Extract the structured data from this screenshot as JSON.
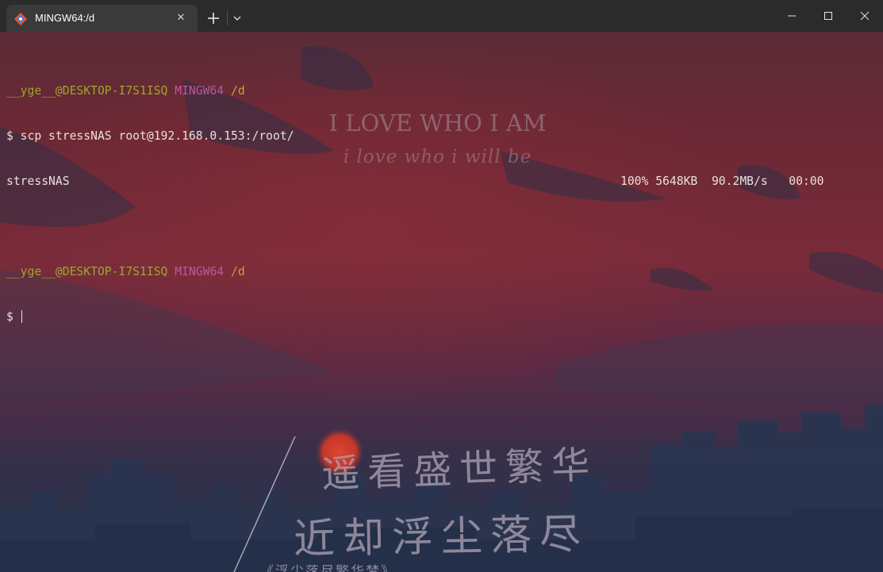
{
  "tab": {
    "title": "MINGW64:/d",
    "close_glyph": "✕",
    "icon": "git-bash-icon"
  },
  "window_controls": [
    "minimize-icon",
    "maximize-icon",
    "close-icon"
  ],
  "terminal": {
    "prompt1": {
      "user": "__yge__@DESKTOP-I7S1ISQ",
      "system": "MINGW64",
      "path": "/d"
    },
    "command": "$ scp stressNAS root@192.168.0.153:/root/",
    "output_file": "stressNAS",
    "output_progress": "100% 5648KB  90.2MB/s   00:00",
    "prompt2": {
      "user": "__yge__@DESKTOP-I7S1ISQ",
      "system": "MINGW64",
      "path": "/d"
    },
    "input_prompt": "$ "
  },
  "wallpaper": {
    "quote": "I LOVE WHO I AM",
    "subquote": "i love who i will be",
    "poem_line1": "遥看盛世繁华",
    "poem_line2": "近却浮尘落尽",
    "poem_title": "《浮尘落尽繁华梦》"
  },
  "colors": {
    "user": "#9fa52a",
    "system": "#c1569c",
    "path": "#c9a133",
    "text": "#e8e0d8",
    "titlebar": "#2b2b2b",
    "tab_active": "#3a3a3a"
  }
}
